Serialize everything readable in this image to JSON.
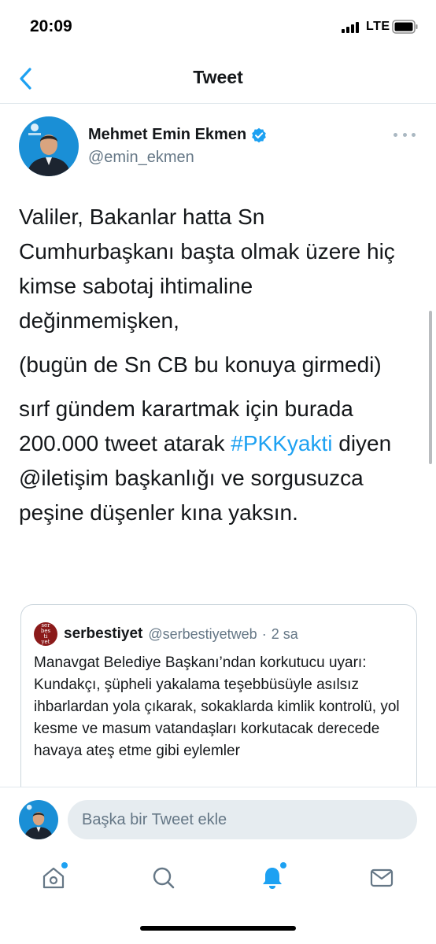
{
  "status_bar": {
    "time": "20:09",
    "network": "LTE"
  },
  "header": {
    "title": "Tweet"
  },
  "tweet": {
    "author_name": "Mehmet Emin Ekmen",
    "author_handle": "@emin_ekmen",
    "paragraphs": {
      "p1": "Valiler, Bakanlar hatta Sn Cumhurbaşkanı başta olmak üzere hiç kimse sabotaj ihtimaline değinmemişken,",
      "p2": "(bugün de Sn CB bu konuya girmedi)",
      "p3_before": "sırf gündem karartmak için burada 200.000 tweet atarak ",
      "p3_hashtag": "#PKKyakti",
      "p3_after": " diyen @iletişim başkanlığı ve sorgusuzca peşine düşenler kına yaksın."
    }
  },
  "quoted_tweet": {
    "name": "serbestiyet",
    "handle": "@serbestiyetweb",
    "separator": "·",
    "time": "2 sa",
    "text": "Manavgat Belediye Başkanı’ndan korkutucu uyarı:  Kundakçı, şüpheli yakalama teşebbüsüyle asılsız ihbarlardan yola çıkarak, sokaklarda kimlik kontrolü, yol kesme ve masum vatandaşları korkutacak derecede havaya ateş etme gibi eylemler"
  },
  "reply": {
    "placeholder": "Başka bir Tweet ekle"
  },
  "tabs": {
    "home_icon": "home-icon",
    "search_icon": "search-icon",
    "notifications_icon": "bell-icon",
    "messages_icon": "mail-icon"
  },
  "colors": {
    "accent": "#1da1f2",
    "secondary_text": "#657786",
    "border": "#e1e8ed"
  }
}
